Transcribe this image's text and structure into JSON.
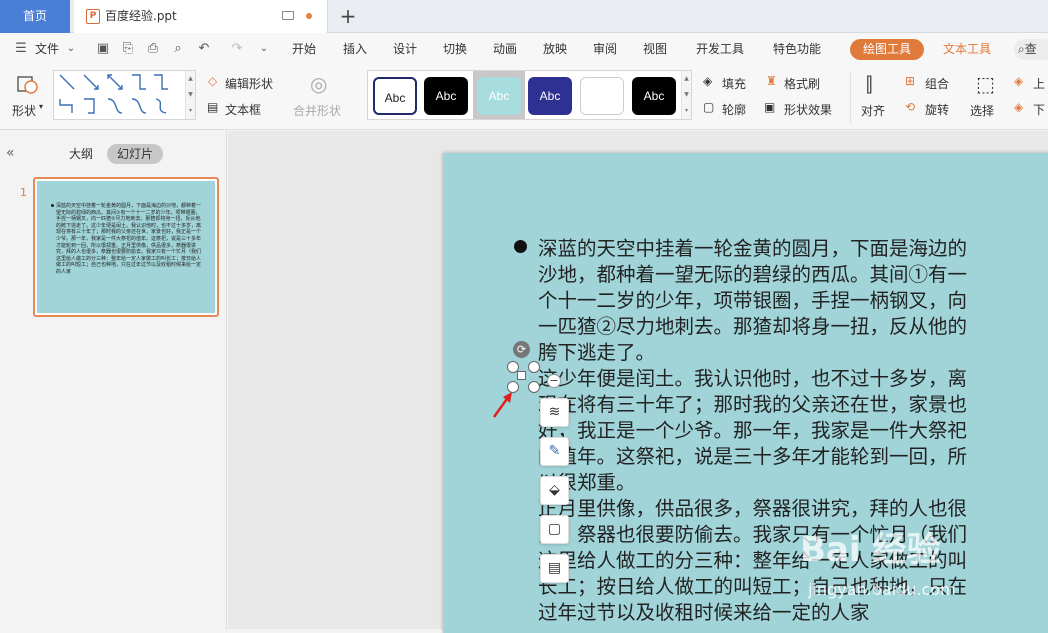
{
  "tabs": {
    "home": "首页",
    "document": "百度经验.ppt",
    "new_tab": "+"
  },
  "menu": {
    "file": "文件",
    "items": [
      "开始",
      "插入",
      "设计",
      "切换",
      "动画",
      "放映",
      "审阅",
      "视图",
      "开发工具",
      "特色功能"
    ],
    "drawing_tools": "绘图工具",
    "text_tools": "文本工具",
    "search": "查"
  },
  "ribbon": {
    "shape": "形状",
    "edit_shape": "编辑形状",
    "text_box": "文本框",
    "merge_shape": "合并形状",
    "style_samples": [
      "Abc",
      "Abc",
      "Abc",
      "Abc",
      "",
      "Abc"
    ],
    "fill": "填充",
    "format_painter": "格式刷",
    "outline": "轮廓",
    "shape_effect": "形状效果",
    "align": "对齐",
    "group": "组合",
    "rotate": "旋转",
    "select": "选择",
    "up": "上",
    "down": "下"
  },
  "panel": {
    "outline_tab": "大纲",
    "slides_tab": "幻灯片",
    "slide_number": "1",
    "thumb_text": "深蓝的天空中挂着一轮金黄的圆月，下面是海边的沙地，都种着一望无际的碧绿的西瓜。其间①有一个十一二岁的少年，项带银圈，手捏一柄钢叉，向一匹猹②尽力地刺去。那猹却将身一扭，反从他的胯下逃走了。这少年便是闰土。我认识他时，也不过十多岁，离现在将有三十年了；那时我的父亲还在世，家景也好，我正是一个少爷。那一年，我家是一件大祭祀的值年。这祭祀，说是三十多年才能轮到一回，所以很郑重。正月里供像，供品很多，祭器很讲究，拜的人也很多，祭器也很要防偷去。我家只有一个忙月（我们这里给人做工的分三种：整年给一定人家做工的叫长工；按日给人做工的叫短工；自己也种地，只在过年过节以及收租时候来给一定的人家"
  },
  "slide": {
    "lines": [
      "深蓝的天空中挂着一轮金黄的圆月，下面是海边的",
      "沙地，都种着一望无际的碧绿的西瓜。其间①有一",
      "个十一二岁的少年，项带银圈，手捏一柄钢叉，向",
      "一匹猹②尽力地刺去。那猹却将身一扭，反从他的",
      "胯下逃走了。",
      "这少年便是闰土。我认识他时，也不过十多岁，离",
      "现在将有三十年了；那时我的父亲还在世，家景也",
      "好，我正是一个少爷。那一年，我家是一件大祭祀",
      "的值年。这祭祀，说是三十多年才能轮到一回，所",
      "以很郑重。",
      "正月里供像，供品很多，祭器很讲究，拜的人也很",
      "多，祭器也很要防偷去。我家只有一个忙月（我们",
      "这里给人做工的分三种：整年给一定人家做工的叫",
      "长工；按日给人做工的叫短工；自己也种地，只在",
      "过年过节以及收租时候来给一定的人家"
    ]
  },
  "watermark": {
    "brand": "Bai 经验",
    "url": "jingyan.baidu.com"
  },
  "colors": {
    "slide_bg": "#a0d4d8",
    "accent_orange": "#e07a3a",
    "home_tab_blue": "#4b7fd6"
  }
}
